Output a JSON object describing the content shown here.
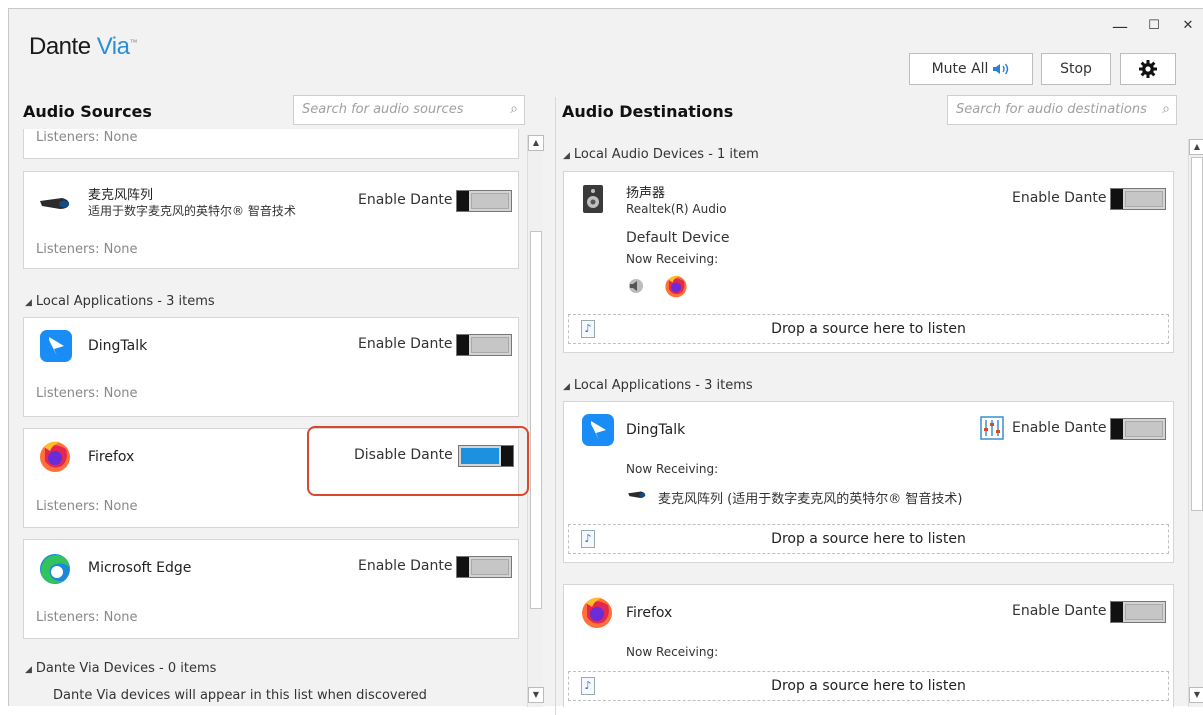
{
  "window": {
    "minimize": "—",
    "maximize": "☐",
    "close": "✕"
  },
  "app": {
    "logo_main": "Dante ",
    "logo_via": "Via",
    "logo_tm": "™"
  },
  "toolbar": {
    "mute_all": "Mute All",
    "stop": "Stop"
  },
  "sources": {
    "title": "Audio Sources",
    "search_placeholder": "Search for audio sources",
    "partial_listeners": "Listeners: None",
    "mic": {
      "name": "麦克风阵列",
      "desc": "适用于数字麦克风的英特尔® 智音技术",
      "toggle_label": "Enable Dante",
      "listeners": "Listeners: None",
      "enabled": false
    },
    "local_apps_header": "Local Applications - 3 items",
    "apps": [
      {
        "name": "DingTalk",
        "toggle_label": "Enable Dante",
        "listeners": "Listeners: None",
        "enabled": false
      },
      {
        "name": "Firefox",
        "toggle_label": "Disable Dante",
        "listeners": "Listeners: None",
        "enabled": true
      },
      {
        "name": "Microsoft Edge",
        "toggle_label": "Enable Dante",
        "listeners": "Listeners: None",
        "enabled": false
      }
    ],
    "via_devices_header": "Dante Via Devices - 0 items",
    "via_devices_note": "Dante Via devices will appear in this list when discovered"
  },
  "destinations": {
    "title": "Audio Destinations",
    "search_placeholder": "Search for audio destinations",
    "local_audio_header": "Local Audio Devices - 1 item",
    "speaker": {
      "name": "扬声器",
      "desc": "Realtek(R) Audio",
      "toggle_label": "Enable Dante",
      "default": "Default Device",
      "now_receiving": "Now Receiving:",
      "drop": "Drop a source here to listen"
    },
    "local_apps_header": "Local Applications - 3 items",
    "dingtalk": {
      "name": "DingTalk",
      "toggle_label": "Enable Dante",
      "now_receiving": "Now Receiving:",
      "receiving_item": "麦克风阵列 (适用于数字麦克风的英特尔® 智音技术)",
      "drop": "Drop a source here to listen"
    },
    "firefox": {
      "name": "Firefox",
      "toggle_label": "Enable Dante",
      "now_receiving": "Now Receiving:",
      "drop": "Drop a source here to listen"
    }
  },
  "colors": {
    "accent": "#1e90e0",
    "highlight": "#d9482b",
    "logo_via": "#2a8fd6"
  }
}
